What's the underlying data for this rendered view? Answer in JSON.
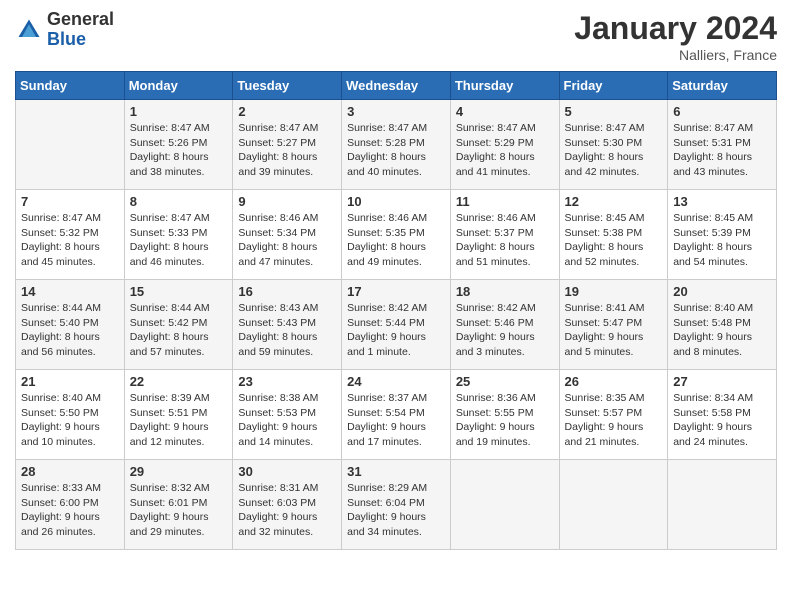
{
  "logo": {
    "general": "General",
    "blue": "Blue"
  },
  "title": "January 2024",
  "location": "Nalliers, France",
  "days_of_week": [
    "Sunday",
    "Monday",
    "Tuesday",
    "Wednesday",
    "Thursday",
    "Friday",
    "Saturday"
  ],
  "weeks": [
    [
      {
        "day": "",
        "info": ""
      },
      {
        "day": "1",
        "info": "Sunrise: 8:47 AM\nSunset: 5:26 PM\nDaylight: 8 hours\nand 38 minutes."
      },
      {
        "day": "2",
        "info": "Sunrise: 8:47 AM\nSunset: 5:27 PM\nDaylight: 8 hours\nand 39 minutes."
      },
      {
        "day": "3",
        "info": "Sunrise: 8:47 AM\nSunset: 5:28 PM\nDaylight: 8 hours\nand 40 minutes."
      },
      {
        "day": "4",
        "info": "Sunrise: 8:47 AM\nSunset: 5:29 PM\nDaylight: 8 hours\nand 41 minutes."
      },
      {
        "day": "5",
        "info": "Sunrise: 8:47 AM\nSunset: 5:30 PM\nDaylight: 8 hours\nand 42 minutes."
      },
      {
        "day": "6",
        "info": "Sunrise: 8:47 AM\nSunset: 5:31 PM\nDaylight: 8 hours\nand 43 minutes."
      }
    ],
    [
      {
        "day": "7",
        "info": "Sunrise: 8:47 AM\nSunset: 5:32 PM\nDaylight: 8 hours\nand 45 minutes."
      },
      {
        "day": "8",
        "info": "Sunrise: 8:47 AM\nSunset: 5:33 PM\nDaylight: 8 hours\nand 46 minutes."
      },
      {
        "day": "9",
        "info": "Sunrise: 8:46 AM\nSunset: 5:34 PM\nDaylight: 8 hours\nand 47 minutes."
      },
      {
        "day": "10",
        "info": "Sunrise: 8:46 AM\nSunset: 5:35 PM\nDaylight: 8 hours\nand 49 minutes."
      },
      {
        "day": "11",
        "info": "Sunrise: 8:46 AM\nSunset: 5:37 PM\nDaylight: 8 hours\nand 51 minutes."
      },
      {
        "day": "12",
        "info": "Sunrise: 8:45 AM\nSunset: 5:38 PM\nDaylight: 8 hours\nand 52 minutes."
      },
      {
        "day": "13",
        "info": "Sunrise: 8:45 AM\nSunset: 5:39 PM\nDaylight: 8 hours\nand 54 minutes."
      }
    ],
    [
      {
        "day": "14",
        "info": "Sunrise: 8:44 AM\nSunset: 5:40 PM\nDaylight: 8 hours\nand 56 minutes."
      },
      {
        "day": "15",
        "info": "Sunrise: 8:44 AM\nSunset: 5:42 PM\nDaylight: 8 hours\nand 57 minutes."
      },
      {
        "day": "16",
        "info": "Sunrise: 8:43 AM\nSunset: 5:43 PM\nDaylight: 8 hours\nand 59 minutes."
      },
      {
        "day": "17",
        "info": "Sunrise: 8:42 AM\nSunset: 5:44 PM\nDaylight: 9 hours\nand 1 minute."
      },
      {
        "day": "18",
        "info": "Sunrise: 8:42 AM\nSunset: 5:46 PM\nDaylight: 9 hours\nand 3 minutes."
      },
      {
        "day": "19",
        "info": "Sunrise: 8:41 AM\nSunset: 5:47 PM\nDaylight: 9 hours\nand 5 minutes."
      },
      {
        "day": "20",
        "info": "Sunrise: 8:40 AM\nSunset: 5:48 PM\nDaylight: 9 hours\nand 8 minutes."
      }
    ],
    [
      {
        "day": "21",
        "info": "Sunrise: 8:40 AM\nSunset: 5:50 PM\nDaylight: 9 hours\nand 10 minutes."
      },
      {
        "day": "22",
        "info": "Sunrise: 8:39 AM\nSunset: 5:51 PM\nDaylight: 9 hours\nand 12 minutes."
      },
      {
        "day": "23",
        "info": "Sunrise: 8:38 AM\nSunset: 5:53 PM\nDaylight: 9 hours\nand 14 minutes."
      },
      {
        "day": "24",
        "info": "Sunrise: 8:37 AM\nSunset: 5:54 PM\nDaylight: 9 hours\nand 17 minutes."
      },
      {
        "day": "25",
        "info": "Sunrise: 8:36 AM\nSunset: 5:55 PM\nDaylight: 9 hours\nand 19 minutes."
      },
      {
        "day": "26",
        "info": "Sunrise: 8:35 AM\nSunset: 5:57 PM\nDaylight: 9 hours\nand 21 minutes."
      },
      {
        "day": "27",
        "info": "Sunrise: 8:34 AM\nSunset: 5:58 PM\nDaylight: 9 hours\nand 24 minutes."
      }
    ],
    [
      {
        "day": "28",
        "info": "Sunrise: 8:33 AM\nSunset: 6:00 PM\nDaylight: 9 hours\nand 26 minutes."
      },
      {
        "day": "29",
        "info": "Sunrise: 8:32 AM\nSunset: 6:01 PM\nDaylight: 9 hours\nand 29 minutes."
      },
      {
        "day": "30",
        "info": "Sunrise: 8:31 AM\nSunset: 6:03 PM\nDaylight: 9 hours\nand 32 minutes."
      },
      {
        "day": "31",
        "info": "Sunrise: 8:29 AM\nSunset: 6:04 PM\nDaylight: 9 hours\nand 34 minutes."
      },
      {
        "day": "",
        "info": ""
      },
      {
        "day": "",
        "info": ""
      },
      {
        "day": "",
        "info": ""
      }
    ]
  ]
}
